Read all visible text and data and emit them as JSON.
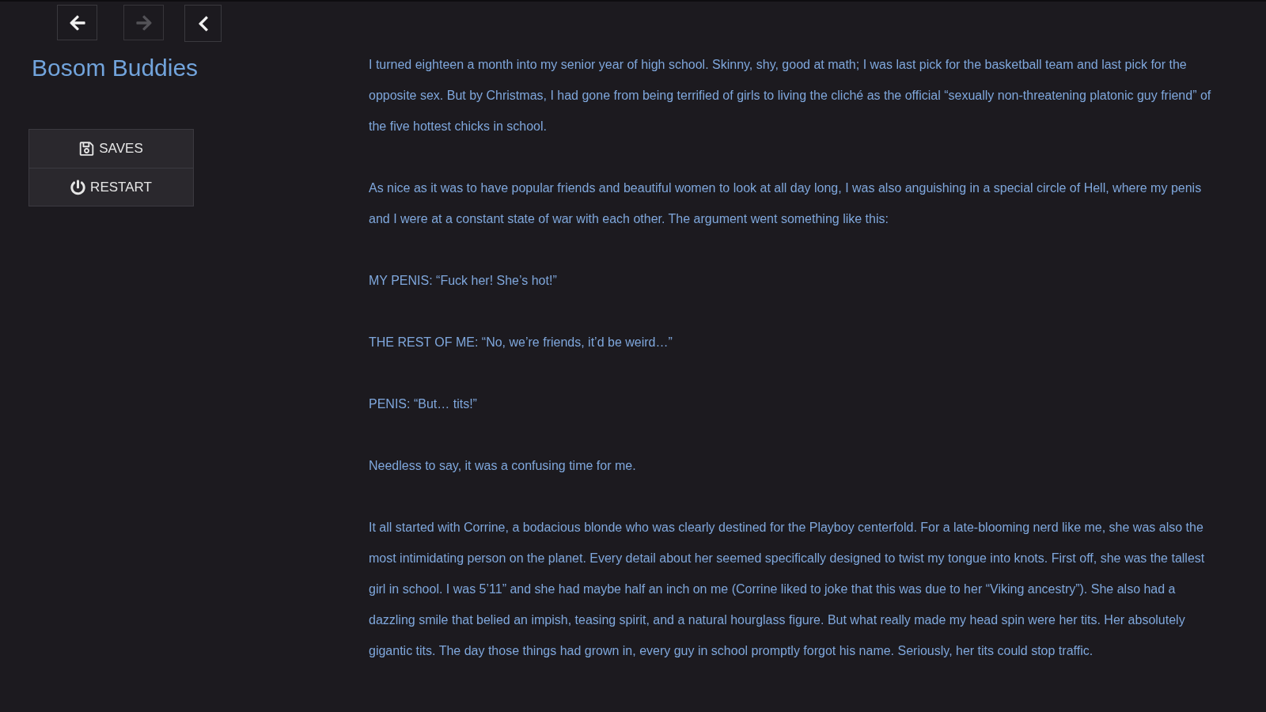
{
  "history": [
    {
      "kind": "back",
      "disabled": false
    },
    {
      "kind": "forward",
      "disabled": true
    }
  ],
  "story_title": "Bosom Buddies",
  "menu": [
    {
      "kind": "saves",
      "label": "SAVES"
    },
    {
      "kind": "restart",
      "label": "RESTART"
    }
  ],
  "passage": [
    "I turned eighteen a month into my senior year of high school. Skinny, shy, good at math; I was last pick for the basketball team and last pick for the opposite sex. But by Christmas, I had gone from being terrified of girls to living the cliché as the official “sexually non-threatening platonic guy friend” of the five hottest chicks in school.",
    "As nice as it was to have popular friends and beautiful women to look at all day long, I was also anguishing in a special circle of Hell, where my penis and I were at a constant state of war with each other. The argument went something like this:",
    "MY PENIS: “Fuck her! She’s hot!”",
    "THE REST OF ME: “No, we’re friends, it’d be weird…”",
    "PENIS: “But… tits!”",
    "Needless to say, it was a confusing time for me.",
    "It all started with Corrine, a bodacious blonde who was clearly destined for the Playboy centerfold. For a late-blooming nerd like me, she was also the most intimidating person on the planet. Every detail about her seemed specifically designed to twist my tongue into knots. First off, she was the tallest girl in school. I was 5’11” and she had maybe half an inch on me (Corrine liked to joke that this was due to her “Viking ancestry”). She also had a dazzling smile that belied an impish, teasing spirit, and a natural hourglass figure. But what really made my head spin were her tits. Her absolutely gigantic tits. The day those things had grown in, every guy in school promptly forgot his name. Seriously, her tits could stop traffic."
  ]
}
